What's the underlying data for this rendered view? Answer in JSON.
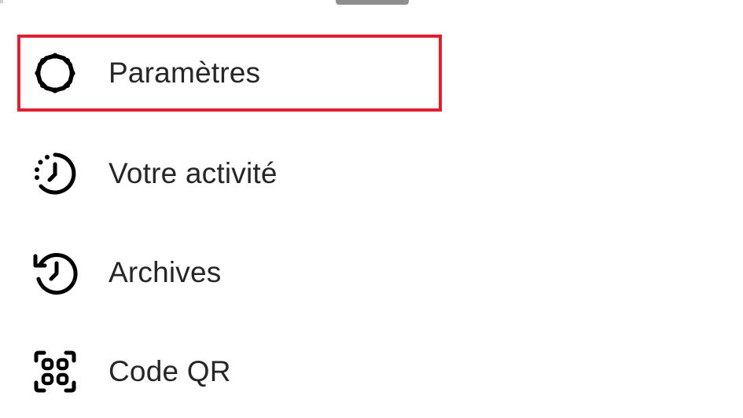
{
  "menu": {
    "items": [
      {
        "label": "Paramètres",
        "icon": "gear-icon",
        "highlighted": true
      },
      {
        "label": "Votre activité",
        "icon": "activity-clock-icon",
        "highlighted": false
      },
      {
        "label": "Archives",
        "icon": "archive-history-icon",
        "highlighted": false
      },
      {
        "label": "Code QR",
        "icon": "qr-code-icon",
        "highlighted": false
      }
    ]
  },
  "colors": {
    "highlight_border": "#e0202e",
    "text": "#262626",
    "icon": "#000000",
    "drag_handle": "#8e8e8e",
    "background": "#ffffff"
  }
}
